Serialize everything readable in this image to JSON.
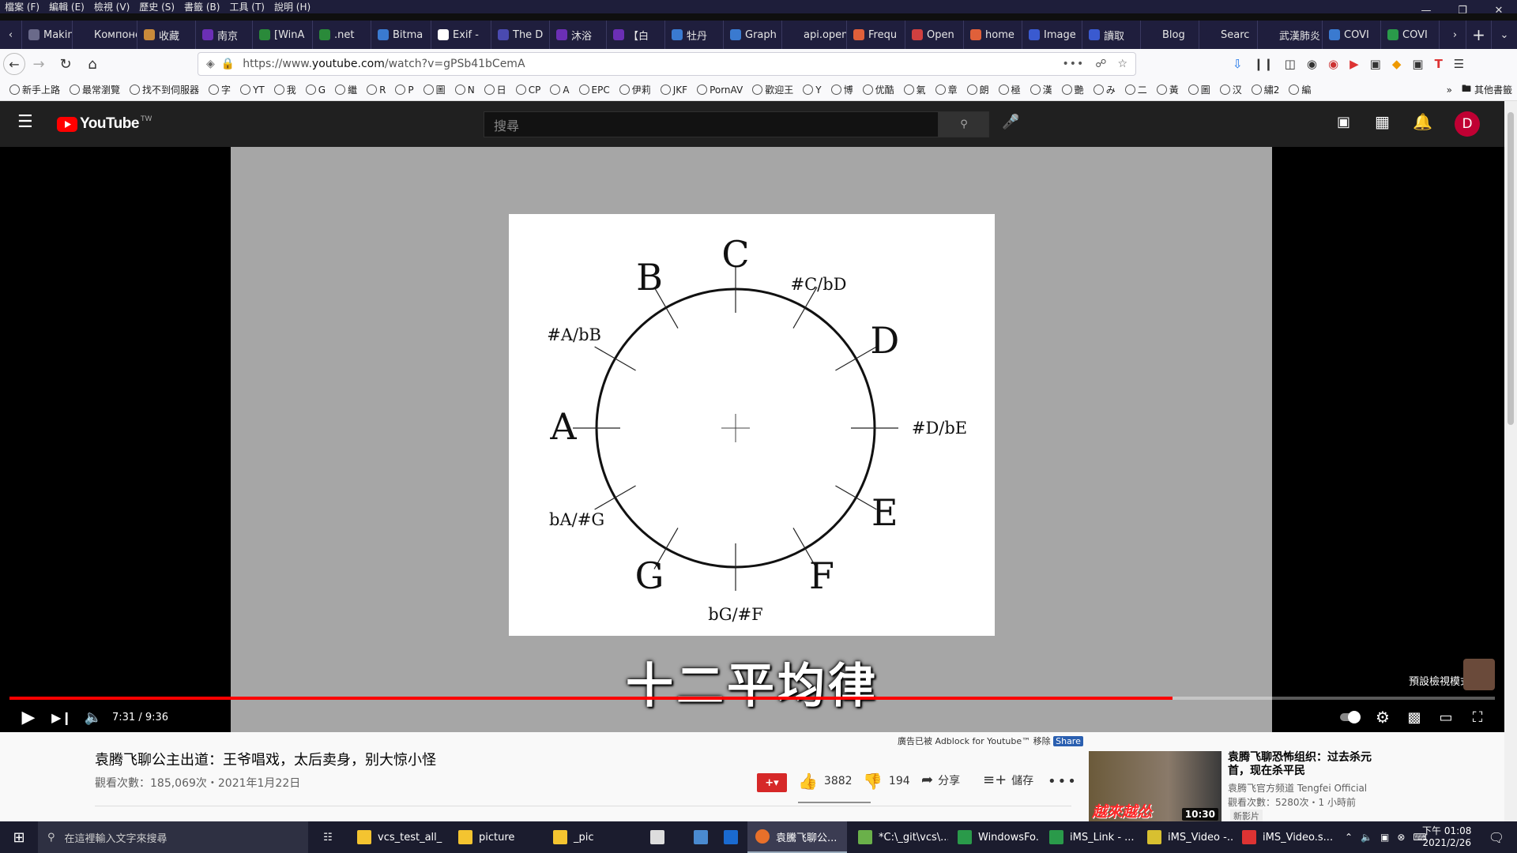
{
  "menubar": {
    "items": [
      "檔案 (F)",
      "編輯 (E)",
      "檢視 (V)",
      "歷史 (S)",
      "書籤 (B)",
      "工具 (T)",
      "說明 (H)"
    ]
  },
  "tabs": [
    {
      "label": "Makin",
      "color": "#6a6a8a"
    },
    {
      "label": "Компонен",
      "color": "#1f1e3d"
    },
    {
      "label": "收藏",
      "color": "#c98a3a"
    },
    {
      "label": "南京",
      "color": "#6b2fb5"
    },
    {
      "label": "[WinA",
      "color": "#2a8a3a"
    },
    {
      "label": ".net",
      "color": "#2a8a3a"
    },
    {
      "label": "Bitma",
      "color": "#3a7ad0"
    },
    {
      "label": "Exif -",
      "color": "#ffffff"
    },
    {
      "label": "The D",
      "color": "#4a4ab0"
    },
    {
      "label": "沐浴",
      "color": "#6b2fb5"
    },
    {
      "label": "【白",
      "color": "#6b2fb5"
    },
    {
      "label": "牡丹",
      "color": "#3a7ad0"
    },
    {
      "label": "Graph",
      "color": "#3a7ad0"
    },
    {
      "label": "api.open",
      "color": "#1f1e3d"
    },
    {
      "label": "Frequ",
      "color": "#e0603a"
    },
    {
      "label": "Open",
      "color": "#d04040"
    },
    {
      "label": "home",
      "color": "#e0603a"
    },
    {
      "label": "Image",
      "color": "#3a5ad0"
    },
    {
      "label": "讀取",
      "color": "#3a5ad0"
    },
    {
      "label": "Blog",
      "color": "#1f1e3d"
    },
    {
      "label": "Searc",
      "color": "#1f1e3d"
    },
    {
      "label": "武漢肺炎",
      "color": "#1f1e3d"
    },
    {
      "label": "COVI",
      "color": "#3a7ad0"
    },
    {
      "label": "COVI",
      "color": "#2a9a4a"
    }
  ],
  "navbar": {
    "url_prefix": "https://www.",
    "url_host": "youtube.com",
    "url_path": "/watch?v=gPSb41bCemA"
  },
  "bookmarks": [
    "新手上路",
    "最常瀏覽",
    "找不到伺服器",
    "字",
    "YT",
    "我",
    "G",
    "繼",
    "R",
    "P",
    "圖",
    "N",
    "日",
    "CP",
    "A",
    "EPC",
    "伊莉",
    "JKF",
    "PornAV",
    "歡迎王",
    "Y",
    "博",
    "优酷",
    "氣",
    "章",
    "朗",
    "極",
    "漢",
    "艷",
    "み",
    "二",
    "黃",
    "圖",
    "汉",
    "繡2",
    "編"
  ],
  "bookmarks_other": "其他書籤",
  "youtube": {
    "logo": "YouTube",
    "logo_sup": "TW",
    "search_placeholder": "搜尋",
    "avatar_letter": "D",
    "avatar_color": "#c00033"
  },
  "diagram": {
    "notes": [
      "C",
      "#C/bD",
      "D",
      "#D/bE",
      "E",
      "F",
      "bG/#F",
      "G",
      "bA/#G",
      "A",
      "#A/bB",
      "B"
    ]
  },
  "player": {
    "subtitle": "十二平均律",
    "time": "7:31 / 9:36",
    "progress": 0.783,
    "default_view_badge": "預設檢視模式 (t)"
  },
  "video": {
    "title": "袁腾飞聊公主出道：王爷唱戏，太后卖身，别大惊小怪",
    "stats": "觀看次數：185,069次・2021年1月22日",
    "likes": "3882",
    "dislikes": "194",
    "share_label": "分享",
    "save_label": "儲存",
    "adblock_note": "廣告已被 Adblock for Youtube™ 移除",
    "share_badge": "Share"
  },
  "recommendation": {
    "title": "袁腾飞聊恐怖组织：过去杀元首，现在杀平民",
    "channel": "袁腾飞官方频道 Tengfei Official",
    "meta": "觀看次數：5280次・1 小時前",
    "badge": "新影片",
    "duration": "10:30",
    "thumb_text": "越來越怂"
  },
  "taskbar": {
    "search_placeholder": "在這裡輸入文字來搜尋",
    "items": [
      "vcs_test_all_...",
      "picture",
      "_pic",
      "袁騰飞聊公...",
      "*C:\\_git\\vcs\\...",
      "WindowsFo...",
      "iMS_Link - ...",
      "iMS_Video -...",
      "iMS_Video.s..."
    ],
    "time": "下午 01:08",
    "date": "2021/2/26"
  }
}
